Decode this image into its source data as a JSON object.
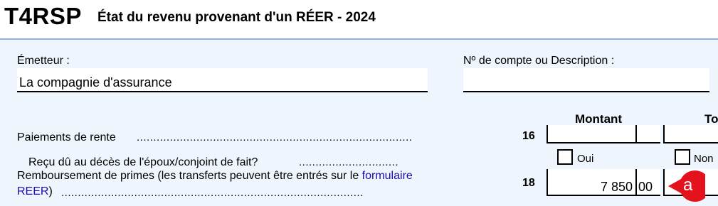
{
  "header": {
    "form_code": "T4RSP",
    "form_title": "État du revenu provenant d'un RÉER - 2024"
  },
  "issuer": {
    "label": "Émetteur :",
    "value": "La compagnie d'assurance"
  },
  "account": {
    "label": "Nº de compte ou Description :",
    "value": ""
  },
  "columns": {
    "amount": "Montant",
    "second": "To"
  },
  "rows": {
    "annuity": {
      "label": "Paiements de rente",
      "leader": "...................................................................................",
      "box": "16",
      "amount_main": "",
      "amount_cents": ""
    },
    "deceased_question": {
      "label": "Reçu dû au décès de l'époux/conjoint de fait?",
      "leader": "..............................",
      "yes_label": "Oui",
      "no_label": "Non"
    },
    "refund": {
      "label_prefix": "Remboursement de primes (les transferts peuvent être entrés sur le ",
      "link_text_1": "formulaire",
      "link_text_2": "REER",
      "label_suffix": ")",
      "leader": "...........................................................................................",
      "box": "18",
      "amount_main": "7 850",
      "amount_cents": "00"
    }
  },
  "badge": {
    "text": "a",
    "color": "#e3121d"
  }
}
